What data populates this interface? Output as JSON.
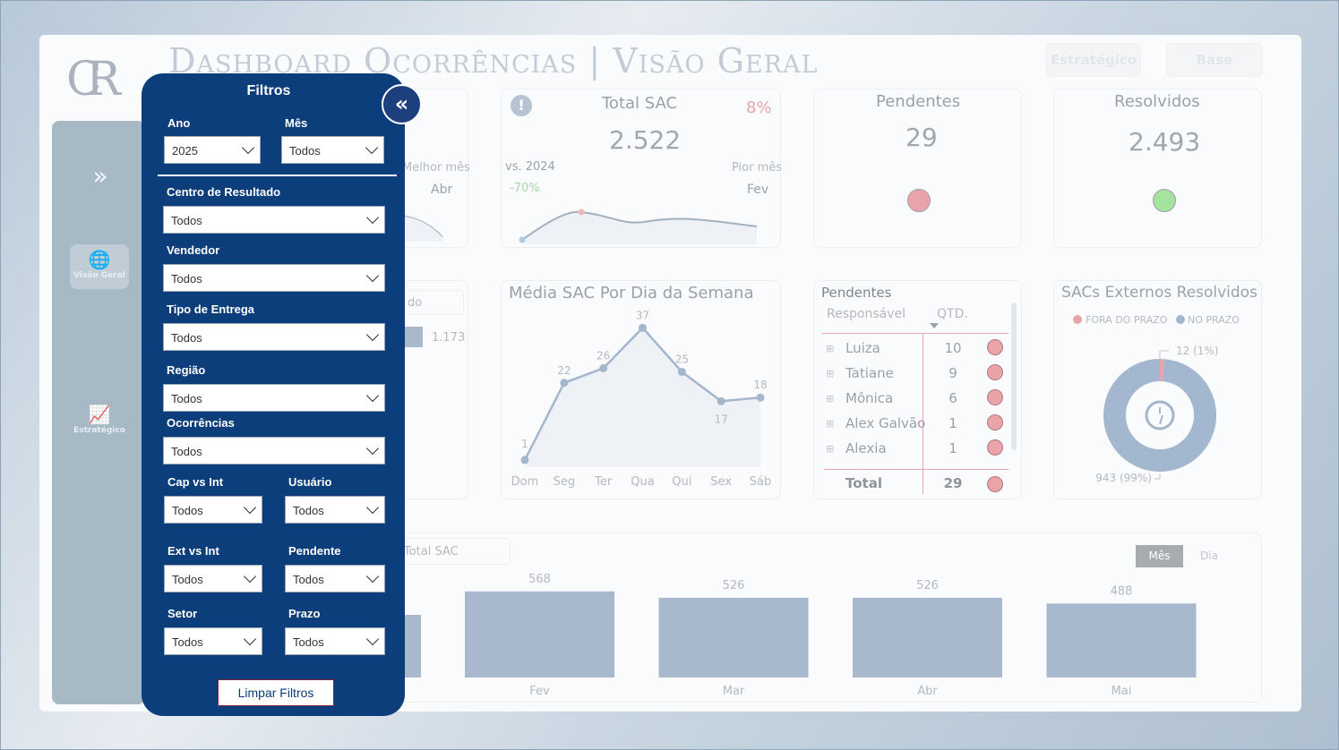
{
  "header": {
    "title": "Dashboard Ocorrências | Visão Geral",
    "logo_text": "CR",
    "btn_estrategico": "Estratégico",
    "btn_base": "Base"
  },
  "nav": {
    "expand": "»",
    "visao_geral": "Visão Geral",
    "estrategico": "Estratégico"
  },
  "kpi_first": {
    "melhor_mes_label": "Melhor mês",
    "melhor_mes_value": "Abr"
  },
  "total_sac": {
    "title": "Total SAC",
    "value": "2.522",
    "pct": "8%",
    "vs_label": "vs. 2024",
    "vs_value": "-70%",
    "pior_mes_label": "Pior mês",
    "pior_mes_value": "Fev"
  },
  "pendentes": {
    "title": "Pendentes",
    "value": "29",
    "color": "#e8a4a9"
  },
  "resolvidos": {
    "title": "Resolvidos",
    "value": "2.493",
    "color": "#a6e3a1"
  },
  "left_partial": {
    "dropdown": "do",
    "value": "1.173"
  },
  "media_dia": {
    "title": "Média SAC Por Dia da Semana"
  },
  "pendentes_table": {
    "title": "Pendentes",
    "col1": "Responsável",
    "col2": "QTD.",
    "rows": [
      {
        "name": "Luiza",
        "qtd": "10"
      },
      {
        "name": "Tatiane",
        "qtd": "9"
      },
      {
        "name": "Mônica",
        "qtd": "6"
      },
      {
        "name": "Alex Galvão",
        "qtd": "1"
      },
      {
        "name": "Alexia",
        "qtd": "1"
      }
    ],
    "total_label": "Total",
    "total_value": "29"
  },
  "sacs_externos": {
    "title": "SACs Externos Resolvidos",
    "legend_fora": "FORA DO PRAZO",
    "legend_no": "NO PRAZO",
    "fora_label": "12 (1%)",
    "no_label": "943 (99%)",
    "fora_color": "#e8a4a9",
    "no_color": "#a3b8cf"
  },
  "bottom_chart": {
    "dropdown": "Total SAC",
    "toggle_mes": "Mês",
    "toggle_dia": "Dia"
  },
  "filters": {
    "title": "Filtros",
    "ano_label": "Ano",
    "ano_value": "2025",
    "mes_label": "Mês",
    "mes_value": "Todos",
    "centro_label": "Centro de Resultado",
    "centro_value": "Todos",
    "vendedor_label": "Vendedor",
    "vendedor_value": "Todos",
    "tipo_label": "Tipo de Entrega",
    "tipo_value": "Todos",
    "regiao_label": "Região",
    "regiao_value": "Todos",
    "ocorrencias_label": "Ocorrências",
    "ocorrencias_value": "Todos",
    "cap_label": "Cap vs Int",
    "cap_value": "Todos",
    "usuario_label": "Usuário",
    "usuario_value": "Todos",
    "ext_label": "Ext vs Int",
    "ext_value": "Todos",
    "pendente_label": "Pendente",
    "pendente_value": "Todos",
    "setor_label": "Setor",
    "setor_value": "Todos",
    "prazo_label": "Prazo",
    "prazo_value": "Todos",
    "clear_button": "Limpar Filtros",
    "collapse_icon": "«"
  },
  "chart_data": [
    {
      "type": "line",
      "title": "Média SAC Por Dia da Semana",
      "categories": [
        "Dom",
        "Seg",
        "Ter",
        "Qua",
        "Qui",
        "Sex",
        "Sáb"
      ],
      "values": [
        1,
        22,
        26,
        37,
        25,
        17,
        18
      ],
      "ylim": [
        0,
        40
      ]
    },
    {
      "type": "bar",
      "categories": [
        "Fev",
        "Mar",
        "Abr",
        "Mai"
      ],
      "values": [
        568,
        526,
        526,
        488
      ],
      "ylim": [
        0,
        620
      ]
    },
    {
      "type": "pie",
      "title": "SACs Externos Resolvidos",
      "categories": [
        "FORA DO PRAZO",
        "NO PRAZO"
      ],
      "values": [
        12,
        943
      ]
    }
  ]
}
